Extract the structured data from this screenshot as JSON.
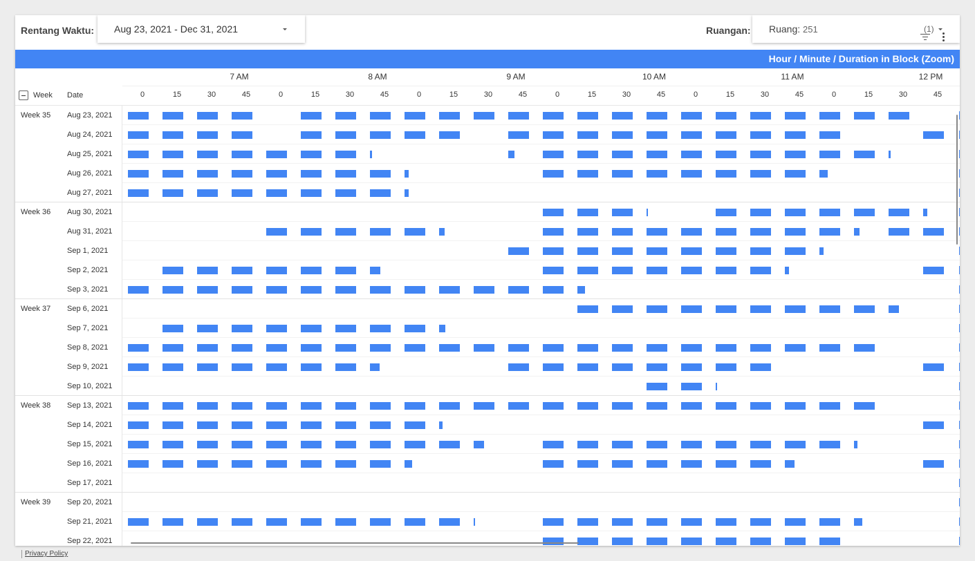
{
  "controls": {
    "date_label": "Rentang Waktu:",
    "date_value": "Aug 23, 2021 - Dec 31, 2021",
    "room_label": "Ruangan:",
    "room_key": "Ruang:",
    "room_value": "251",
    "room_count": "(1)"
  },
  "banner": "Hour / Minute / Duration in Block (Zoom)",
  "headers": {
    "week": "Week",
    "date": "Date",
    "hours": [
      "7 AM",
      "8 AM",
      "9 AM",
      "10 AM",
      "11 AM",
      "12 PM"
    ],
    "minutes": [
      "0",
      "15",
      "30",
      "45",
      "0",
      "15",
      "30",
      "45",
      "0",
      "15",
      "30",
      "45",
      "0",
      "15",
      "30",
      "45",
      "0",
      "15",
      "30",
      "45",
      "0",
      "15",
      "30",
      "45"
    ]
  },
  "accent_color": "#4285f4",
  "rows": [
    {
      "week": "Week 35",
      "date": "Aug 23, 2021",
      "blocks": [
        [
          0,
          4
        ],
        [
          5,
          23
        ]
      ]
    },
    {
      "week": "",
      "date": "Aug 24, 2021",
      "blocks": [
        [
          0,
          4
        ],
        [
          5,
          9
        ],
        [
          9,
          10
        ],
        [
          11,
          12
        ],
        [
          12,
          20
        ],
        [
          20,
          21
        ],
        [
          23,
          24
        ]
      ]
    },
    {
      "week": "",
      "date": "Aug 25, 2021",
      "blocks": [
        [
          0,
          7
        ],
        [
          7,
          7.1
        ],
        [
          11,
          11.3
        ],
        [
          12,
          22
        ],
        [
          22,
          22.1
        ]
      ]
    },
    {
      "week": "",
      "date": "Aug 26, 2021",
      "blocks": [
        [
          0,
          4
        ],
        [
          4,
          8
        ],
        [
          8,
          8.2
        ],
        [
          12,
          20
        ],
        [
          20,
          20.4
        ]
      ]
    },
    {
      "week": "",
      "date": "Aug 27, 2021",
      "blocks": [
        [
          0,
          8
        ],
        [
          8,
          8.2
        ]
      ]
    },
    {
      "week": "Week 36",
      "date": "Aug 30, 2021",
      "blocks": [
        [
          12,
          15
        ],
        [
          15,
          15.05
        ],
        [
          17,
          23
        ],
        [
          23,
          23.2
        ]
      ]
    },
    {
      "week": "",
      "date": "Aug 31, 2021",
      "blocks": [
        [
          4,
          9
        ],
        [
          9,
          9.25
        ],
        [
          12,
          21
        ],
        [
          21,
          21.25
        ],
        [
          22,
          24
        ]
      ]
    },
    {
      "week": "",
      "date": "Sep 1, 2021",
      "blocks": [
        [
          11,
          20
        ],
        [
          20,
          20.2
        ]
      ]
    },
    {
      "week": "",
      "date": "Sep 2, 2021",
      "blocks": [
        [
          1,
          4
        ],
        [
          4,
          7
        ],
        [
          7,
          7.5
        ],
        [
          12,
          19
        ],
        [
          19,
          19.2
        ],
        [
          23,
          24
        ]
      ]
    },
    {
      "week": "",
      "date": "Sep 3, 2021",
      "blocks": [
        [
          0,
          12
        ],
        [
          12,
          13
        ],
        [
          13,
          13.35
        ]
      ]
    },
    {
      "week": "Week 37",
      "date": "Sep 6, 2021",
      "blocks": [
        [
          13,
          20
        ],
        [
          20,
          22
        ],
        [
          22,
          22.5
        ]
      ]
    },
    {
      "week": "",
      "date": "Sep 7, 2021",
      "blocks": [
        [
          1,
          8
        ],
        [
          8,
          9
        ],
        [
          9,
          9.3
        ]
      ]
    },
    {
      "week": "",
      "date": "Sep 8, 2021",
      "blocks": [
        [
          0,
          20
        ],
        [
          20,
          22
        ]
      ]
    },
    {
      "week": "",
      "date": "Sep 9, 2021",
      "blocks": [
        [
          0,
          4
        ],
        [
          4,
          7
        ],
        [
          7,
          7.45
        ],
        [
          11,
          19
        ],
        [
          23,
          24
        ]
      ]
    },
    {
      "week": "",
      "date": "Sep 10, 2021",
      "blocks": [
        [
          15,
          17
        ],
        [
          17,
          17.05
        ]
      ]
    },
    {
      "week": "Week 38",
      "date": "Sep 13, 2021",
      "blocks": [
        [
          0,
          21
        ],
        [
          21,
          22
        ]
      ]
    },
    {
      "week": "",
      "date": "Sep 14, 2021",
      "blocks": [
        [
          0,
          8
        ],
        [
          8,
          9
        ],
        [
          9,
          9.15
        ],
        [
          23,
          24
        ]
      ]
    },
    {
      "week": "",
      "date": "Sep 15, 2021",
      "blocks": [
        [
          0,
          10
        ],
        [
          10,
          10.5
        ],
        [
          12,
          20
        ],
        [
          20,
          21
        ],
        [
          21,
          21.15
        ]
      ]
    },
    {
      "week": "",
      "date": "Sep 16, 2021",
      "blocks": [
        [
          0,
          8
        ],
        [
          8,
          8.35
        ],
        [
          12,
          19
        ],
        [
          19,
          19.45
        ],
        [
          23,
          24
        ]
      ]
    },
    {
      "week": "",
      "date": "Sep 17, 2021",
      "blocks": []
    },
    {
      "week": "Week 39",
      "date": "Sep 20, 2021",
      "blocks": []
    },
    {
      "week": "",
      "date": "Sep 21, 2021",
      "blocks": [
        [
          0,
          9
        ],
        [
          9,
          10
        ],
        [
          10,
          10.05
        ],
        [
          12,
          20
        ],
        [
          20,
          21
        ],
        [
          21,
          21.4
        ]
      ]
    },
    {
      "week": "",
      "date": "Sep 22, 2021",
      "blocks": [
        [
          12,
          20
        ],
        [
          20,
          21
        ]
      ]
    }
  ],
  "footer": {
    "privacy": "Privacy Policy"
  }
}
